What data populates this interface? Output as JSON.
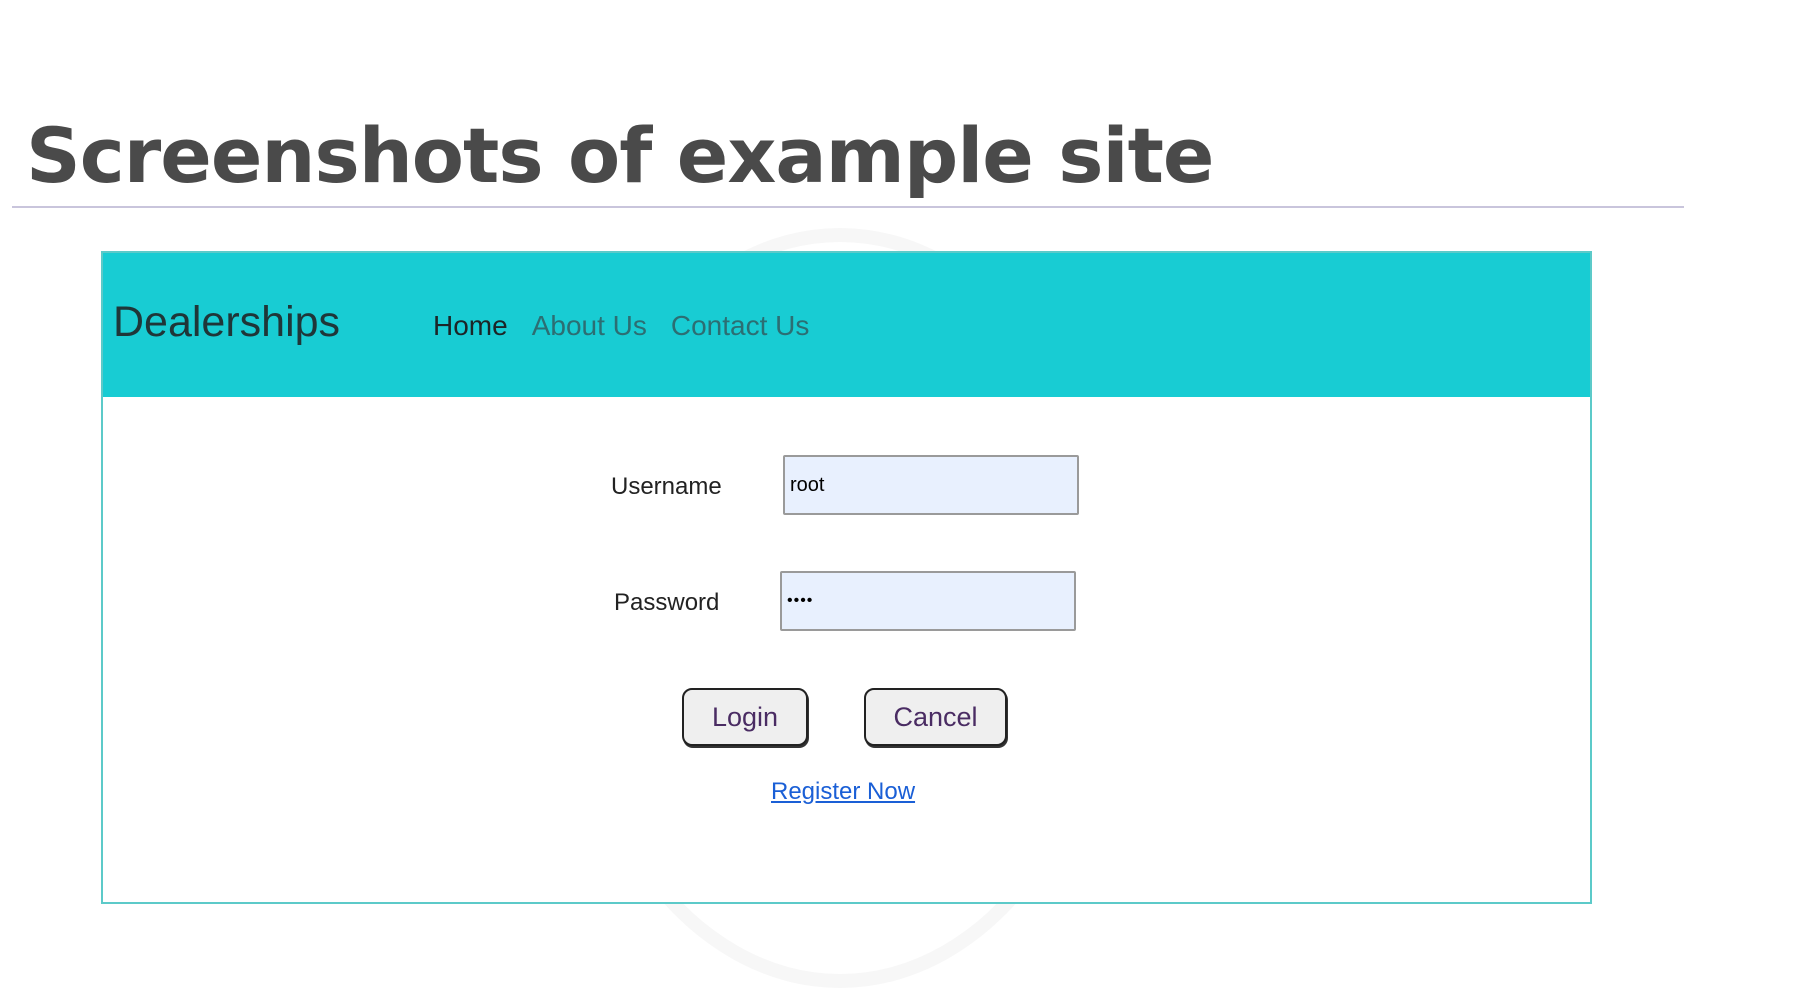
{
  "slide": {
    "title": "Screenshots of example site"
  },
  "site": {
    "brand": "Dealerships",
    "nav": {
      "home": "Home",
      "about": "About Us",
      "contact": "Contact Us"
    },
    "login_form": {
      "username_label": "Username",
      "username_value": "root",
      "password_label": "Password",
      "password_value": "••••",
      "login_button": "Login",
      "cancel_button": "Cancel",
      "register_link": "Register Now"
    }
  },
  "colors": {
    "navbar": "#18ccd3",
    "frame_border": "#5ccac9",
    "input_background": "#e8f0fe",
    "link": "#1a5fd6"
  }
}
